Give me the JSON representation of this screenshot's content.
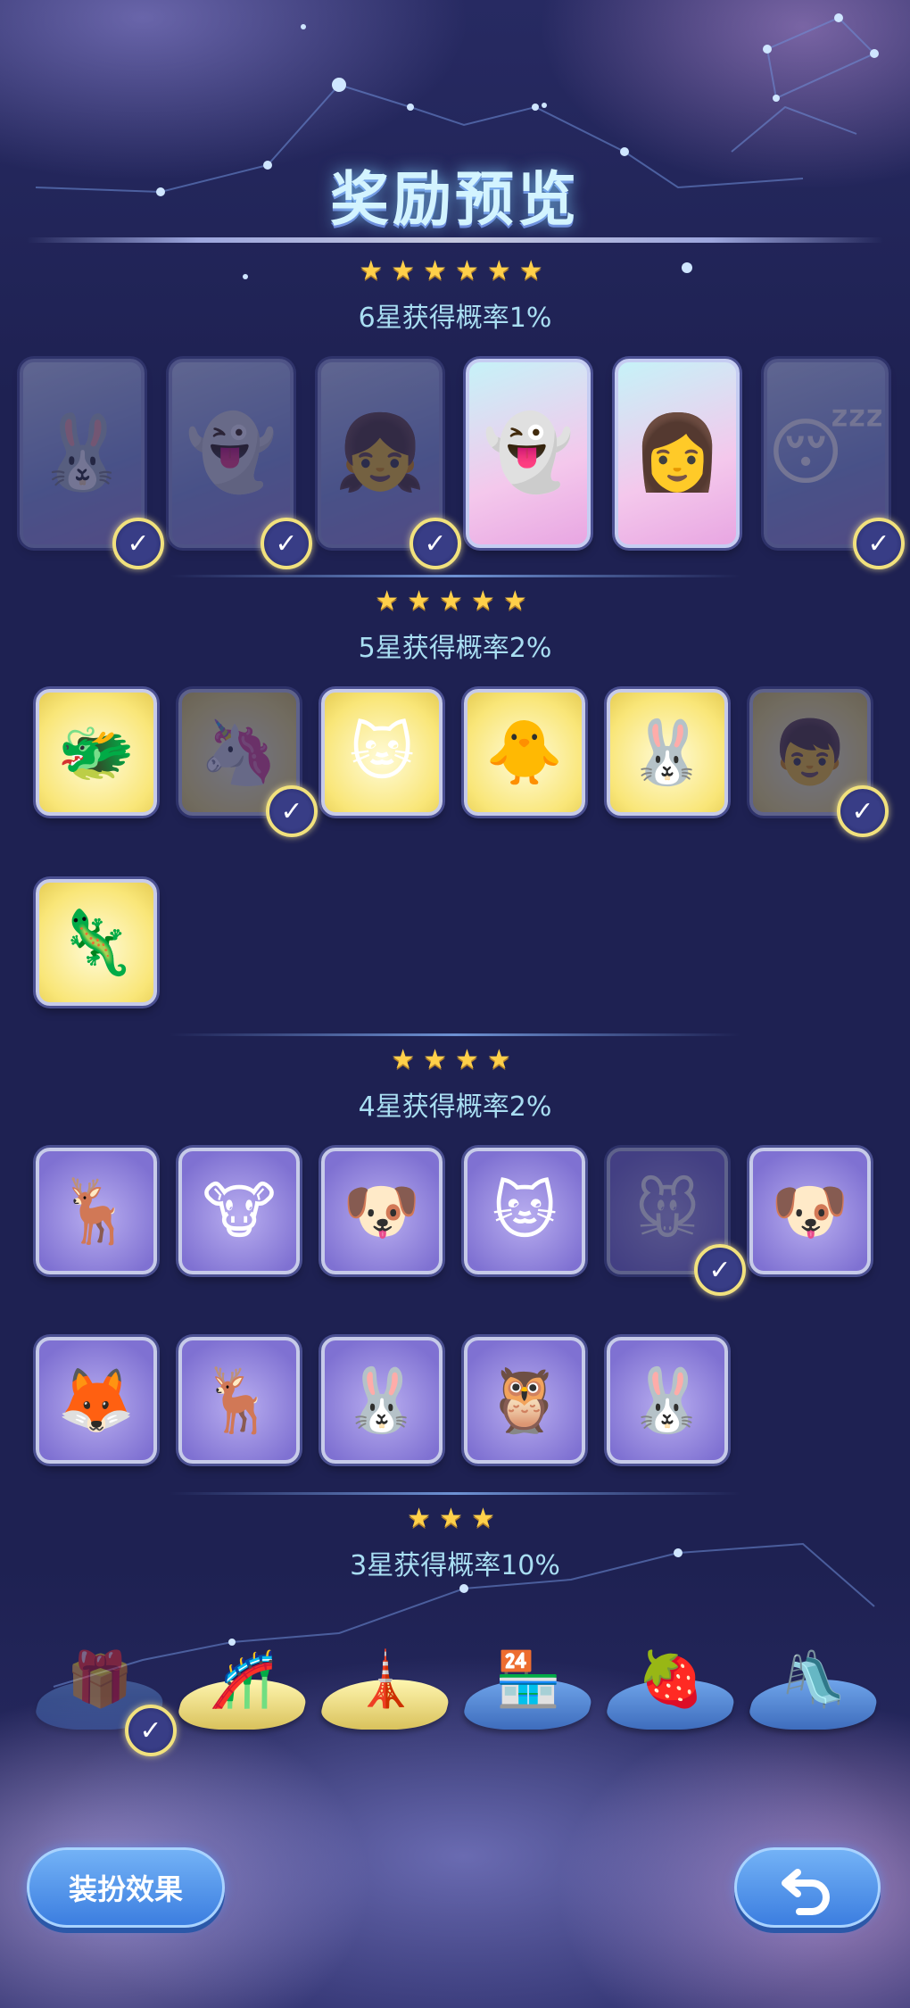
{
  "header": {
    "title": "奖励预览"
  },
  "colors": {
    "background": "#1f2152",
    "star": "#ffd04a",
    "button": "#3c7ee0",
    "probability_text": "#a9def2"
  },
  "sections": [
    {
      "stars": "★★★★★★",
      "probability": "6星获得概率1%",
      "items": [
        {
          "icon": "red-bunny-hood-costume",
          "glyph": "🐰",
          "owned": true
        },
        {
          "icon": "green-scarf-ghost-costume",
          "glyph": "👻",
          "owned": true
        },
        {
          "icon": "orange-hair-girl-costume",
          "glyph": "👧",
          "owned": true
        },
        {
          "icon": "white-spiral-ghost-costume",
          "glyph": "👻",
          "owned": false
        },
        {
          "icon": "white-hair-doll-costume",
          "glyph": "👩",
          "owned": false
        },
        {
          "icon": "sleeping-cloud-costume",
          "glyph": "😴",
          "owned": true
        }
      ]
    },
    {
      "stars": "★★★★★",
      "probability": "5星获得概率2%",
      "items": [
        {
          "icon": "pink-dragon-head",
          "glyph": "🐲",
          "owned": false
        },
        {
          "icon": "unicorn-head",
          "glyph": "🦄",
          "owned": true
        },
        {
          "icon": "lynx-head",
          "glyph": "🐱",
          "owned": false
        },
        {
          "icon": "duck-head",
          "glyph": "🐥",
          "owned": false
        },
        {
          "icon": "party-bunny-head",
          "glyph": "🐰",
          "owned": false
        },
        {
          "icon": "blue-hair-kid-head",
          "glyph": "👦",
          "owned": true
        },
        {
          "icon": "axolotl-goggles-head",
          "glyph": "🦎",
          "owned": false
        }
      ]
    },
    {
      "stars": "★★★★",
      "probability": "4星获得概率2%",
      "items": [
        {
          "icon": "deer-green-hat-head",
          "glyph": "🦌",
          "owned": false
        },
        {
          "icon": "bull-head",
          "glyph": "🐮",
          "owned": false
        },
        {
          "icon": "white-dog-head",
          "glyph": "🐶",
          "owned": false
        },
        {
          "icon": "steampunk-cat-head",
          "glyph": "🐱",
          "owned": false
        },
        {
          "icon": "mouse-head",
          "glyph": "🐭",
          "owned": true
        },
        {
          "icon": "brown-bow-dog-head",
          "glyph": "🐶",
          "owned": false
        },
        {
          "icon": "red-fox-head",
          "glyph": "🦊",
          "owned": false
        },
        {
          "icon": "antler-girl-head",
          "glyph": "🦌",
          "owned": false
        },
        {
          "icon": "patch-bunny-head",
          "glyph": "🐰",
          "owned": false
        },
        {
          "icon": "top-hat-owl-head",
          "glyph": "🦉",
          "owned": false
        },
        {
          "icon": "clown-bunny-head",
          "glyph": "🐰",
          "owned": false
        }
      ]
    },
    {
      "stars": "★★★",
      "probability": "3星获得概率10%",
      "items": [
        {
          "icon": "gift-house-island",
          "glyph": "🎁",
          "owned": true
        },
        {
          "icon": "roller-coaster-island",
          "glyph": "🎢",
          "owned": false
        },
        {
          "icon": "tower-island",
          "glyph": "🗼",
          "owned": false
        },
        {
          "icon": "shop-stall-island",
          "glyph": "🏪",
          "owned": false
        },
        {
          "icon": "strawberry-house-island",
          "glyph": "🍓",
          "owned": false
        },
        {
          "icon": "slide-island",
          "glyph": "🛝",
          "owned": false
        }
      ]
    }
  ],
  "footer": {
    "dress_button": "装扮效果",
    "back_icon": "return-arrow-icon"
  }
}
